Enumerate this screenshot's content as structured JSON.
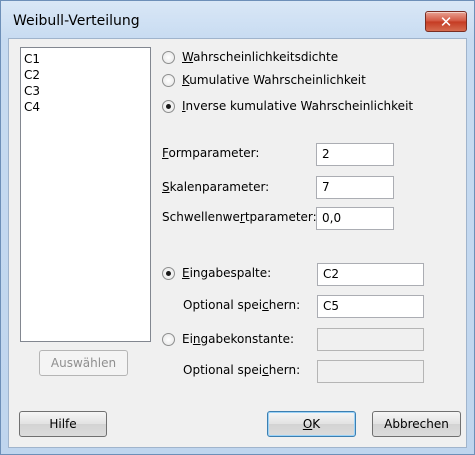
{
  "window": {
    "title": "Weibull-Verteilung",
    "close_label": "✕"
  },
  "variables": [
    "C1",
    "C2",
    "C3",
    "C4"
  ],
  "select_button": "Auswählen",
  "mode_options": [
    {
      "prefix": "",
      "accel": "W",
      "rest": "ahrscheinlichkeitsdichte",
      "checked": false
    },
    {
      "prefix": "",
      "accel": "K",
      "rest": "umulative Wahrscheinlichkeit",
      "checked": false
    },
    {
      "prefix": "",
      "accel": "I",
      "rest": "nverse kumulative Wahrscheinlichkeit",
      "checked": true
    }
  ],
  "params": {
    "shape": {
      "prefix": "",
      "accel": "F",
      "rest": "ormparameter:",
      "value": "2"
    },
    "scale": {
      "prefix": "",
      "accel": "S",
      "rest": "kalenparameter:",
      "value": "7"
    },
    "threshold": {
      "prefix": "Schwellenwe",
      "accel": "r",
      "rest": "tparameter:",
      "value": "0,0"
    }
  },
  "input_column": {
    "prefix": "",
    "accel": "E",
    "rest": "ingabespalte:",
    "checked": true,
    "value": "C2",
    "store_prefix": "Optional spei",
    "store_accel": "c",
    "store_rest": "hern:",
    "store_value": "C5"
  },
  "input_constant": {
    "prefix": "Ei",
    "accel": "n",
    "rest": "gabekonstante:",
    "checked": false,
    "value": "",
    "store_prefix": "Optional spei",
    "store_accel": "c",
    "store_rest": "hern:",
    "store_value": ""
  },
  "buttons": {
    "help": "Hilfe",
    "ok_accel": "O",
    "ok_rest": "K",
    "cancel": "Abbrechen"
  }
}
